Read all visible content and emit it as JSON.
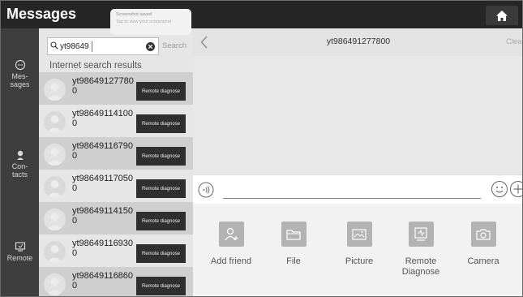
{
  "app": {
    "title": "Messages"
  },
  "toast": {
    "title": "Screenshot saved",
    "subtitle": "Tap to view your screenshot"
  },
  "topbar": {
    "home_icon": "home-icon"
  },
  "nav": {
    "items": [
      {
        "label_1": "Mes-",
        "label_2": "sages",
        "icon": "chat-icon"
      },
      {
        "label_1": "Con-",
        "label_2": "tacts",
        "icon": "contact-icon"
      },
      {
        "label_1": "Remote",
        "label_2": "",
        "icon": "remote-icon"
      }
    ]
  },
  "search": {
    "value": "yt98649",
    "button_label": "Search"
  },
  "results": {
    "label": "Internet search results",
    "button_label": "Remote diagnose",
    "users": [
      {
        "line1": "yt98649127780",
        "line2": "0"
      },
      {
        "line1": "yt98649114100",
        "line2": "0"
      },
      {
        "line1": "yt98649116790",
        "line2": "0"
      },
      {
        "line1": "yt98649117050",
        "line2": "0"
      },
      {
        "line1": "yt98649114150",
        "line2": "0"
      },
      {
        "line1": "yt98649116930",
        "line2": "0"
      },
      {
        "line1": "yt98649116860",
        "line2": "0"
      }
    ]
  },
  "chat": {
    "title": "yt986491277800",
    "clear_label": "Clear"
  },
  "tools": [
    {
      "label": "Add friend",
      "icon": "add-friend-icon"
    },
    {
      "label": "File",
      "icon": "folder-icon"
    },
    {
      "label": "Picture",
      "icon": "picture-icon"
    },
    {
      "label": "Remote\nDiagnose",
      "icon": "remote-diagnose-icon"
    },
    {
      "label": "Camera",
      "icon": "camera-icon"
    }
  ]
}
